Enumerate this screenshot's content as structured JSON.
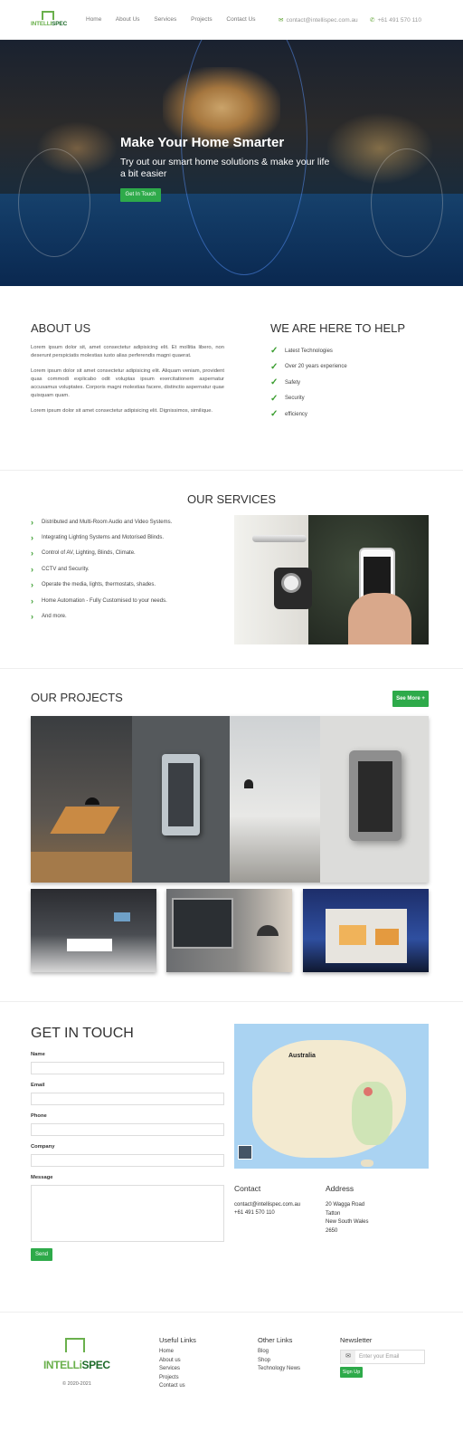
{
  "nav": {
    "logo_text_a": "INTELLI",
    "logo_text_b": "SPEC",
    "items": [
      "Home",
      "About Us",
      "Services",
      "Projects",
      "Contact Us"
    ],
    "email": "contact@intellispec.com.au",
    "phone": "+61 491 570 110"
  },
  "hero": {
    "title": "Make Your Home Smarter",
    "subtitle": "Try out our smart home solutions & make your life a bit easier",
    "button": "Get In Touch"
  },
  "about": {
    "title": "ABOUT US",
    "paragraphs": [
      "Lorem ipsum dolor sit, amet consectetur adipisicing elit. Et mollitia libero, non deserunt perspiciatis molestias iusto alias perferendis magni quaerat.",
      "Lorem ipsum dolor sit amet consectetur adipisicing elit. Aliquam veniam, provident quas commodi explicabo odit voluptas ipsum exercitationem aspernatur accusamus voluptates. Corporis magni molestias facere, distinctio aspernatur quae quisquam quam.",
      "Lorem ipsum dolor sit amet consectetur adipisicing elit. Dignissimos, similique."
    ]
  },
  "help": {
    "title": "WE ARE HERE TO HELP",
    "items": [
      "Latest Technologies",
      "Over 20 years experience",
      "Safety",
      "Security",
      "efficiency"
    ]
  },
  "services": {
    "title": "OUR SERVICES",
    "items": [
      "Distributed and Multi-Room Audio and Video Systems.",
      "Integrating Lighting Systems and Motorised Blinds.",
      "Control of AV, Lighting, Blinds, Climate.",
      "CCTV and Security.",
      "Operate the media, lights, thermostats, shades.",
      "Home Automation - Fully Customised to your needs.",
      "And more."
    ]
  },
  "projects": {
    "title": "OUR PROJECTS",
    "button": "See More",
    "button_icon": "+"
  },
  "contact": {
    "title": "GET IN TOUCH",
    "fields": [
      "Name",
      "Email",
      "Phone",
      "Company",
      "Message"
    ],
    "send": "Send",
    "contact_title": "Contact",
    "email": "contact@intellispec.com.au",
    "phone": "+61 491 570 110",
    "address_title": "Address",
    "address": [
      "20 Wagga Road",
      "Tatton",
      "New South Wales",
      "2650"
    ],
    "map_label": "Australia"
  },
  "footer": {
    "logo_text_a": "INTELLi",
    "logo_text_b": "SPEC",
    "copyright": "© 2020-2021",
    "useful_title": "Useful Links",
    "useful": [
      "Home",
      "About us",
      "Services",
      "Projects",
      "Contact us"
    ],
    "other_title": "Other Links",
    "other": [
      "Blog",
      "Shop",
      "Technology News"
    ],
    "newsletter_title": "Newsletter",
    "email_placeholder": "Enter your Email",
    "signup": "Sign Up"
  },
  "colors": {
    "accent": "#2eaa4a",
    "check": "#3a9d2f",
    "logo": "#6ab04c"
  }
}
